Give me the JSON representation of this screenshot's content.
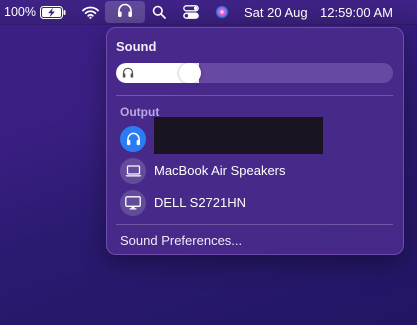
{
  "menubar": {
    "battery_percent": "100%",
    "date": "Sat 20 Aug",
    "time": "12:59:00 AM",
    "icons": [
      "battery-charging-icon",
      "wifi-icon",
      "headphones-icon",
      "search-icon",
      "control-center-icon",
      "siri-icon"
    ]
  },
  "sound_panel": {
    "title": "Sound",
    "volume_fraction": 0.3,
    "output_label": "Output",
    "devices": [
      {
        "label": "",
        "icon": "headphones-icon",
        "selected": true
      },
      {
        "label": "MacBook Air Speakers",
        "icon": "laptop-icon",
        "selected": false
      },
      {
        "label": "DELL S2721HN",
        "icon": "monitor-icon",
        "selected": false
      }
    ],
    "preferences_label": "Sound Preferences..."
  },
  "colors": {
    "selected_device": "#2b7cf2",
    "section_label": "#b9a7e6"
  }
}
